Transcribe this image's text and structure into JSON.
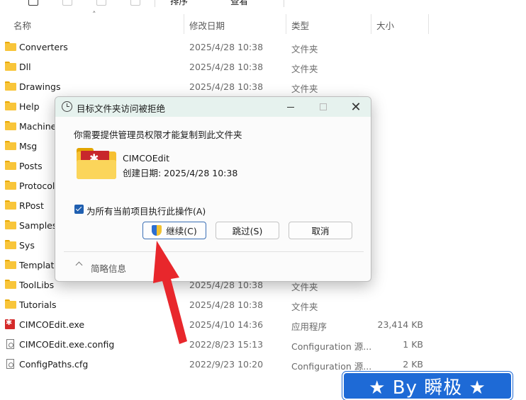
{
  "toolbar": {
    "sort_label": "排序",
    "view_label": "查看"
  },
  "columns": {
    "name": "名称",
    "modified": "修改日期",
    "type": "类型",
    "size": "大小"
  },
  "files": [
    {
      "icon": "folder-icon",
      "name": "Converters",
      "date": "2025/4/28 10:38",
      "type": "文件夹",
      "size": ""
    },
    {
      "icon": "folder-icon",
      "name": "Dll",
      "date": "2025/4/28 10:38",
      "type": "文件夹",
      "size": ""
    },
    {
      "icon": "folder-icon",
      "name": "Drawings",
      "date": "2025/4/28 10:38",
      "type": "文件夹",
      "size": ""
    },
    {
      "icon": "folder-icon",
      "name": "Help",
      "date": "",
      "type": "",
      "size": ""
    },
    {
      "icon": "folder-icon",
      "name": "Machine",
      "date": "",
      "type": "",
      "size": ""
    },
    {
      "icon": "folder-icon",
      "name": "Msg",
      "date": "",
      "type": "",
      "size": ""
    },
    {
      "icon": "folder-icon",
      "name": "Posts",
      "date": "",
      "type": "",
      "size": ""
    },
    {
      "icon": "folder-icon",
      "name": "Protocol",
      "date": "",
      "type": "",
      "size": ""
    },
    {
      "icon": "folder-icon",
      "name": "RPost",
      "date": "",
      "type": "",
      "size": ""
    },
    {
      "icon": "folder-icon",
      "name": "Samples",
      "date": "",
      "type": "",
      "size": ""
    },
    {
      "icon": "folder-icon",
      "name": "Sys",
      "date": "",
      "type": "",
      "size": ""
    },
    {
      "icon": "folder-icon",
      "name": "Template",
      "date": "",
      "type": "",
      "size": ""
    },
    {
      "icon": "folder-icon",
      "name": "ToolLibs",
      "date": "2025/4/28 10:38",
      "type": "文件夹",
      "size": ""
    },
    {
      "icon": "folder-icon",
      "name": "Tutorials",
      "date": "2025/4/28 10:38",
      "type": "文件夹",
      "size": ""
    },
    {
      "icon": "exe-icon",
      "name": "CIMCOEdit.exe",
      "date": "2025/4/10 14:36",
      "type": "应用程序",
      "size": "23,414 KB"
    },
    {
      "icon": "config-file-icon",
      "name": "CIMCOEdit.exe.config",
      "date": "2022/8/23 15:13",
      "type": "Configuration 源...",
      "size": "1 KB"
    },
    {
      "icon": "config-file-icon",
      "name": "ConfigPaths.cfg",
      "date": "2022/9/23 10:20",
      "type": "Configuration 源...",
      "size": "2 KB"
    }
  ],
  "dialog": {
    "title": "目标文件夹访问被拒绝",
    "message": "你需要提供管理员权限才能复制到此文件夹",
    "item_name": "CIMCOEdit",
    "item_date": "创建日期: 2025/4/28 10:38",
    "checkbox_label": "为所有当前项目执行此操作(A)",
    "checkbox_checked": true,
    "continue_label": "继续(C)",
    "skip_label": "跳过(S)",
    "cancel_label": "取消",
    "summary_label": "简略信息"
  },
  "watermark": {
    "text": "★ By 瞬极 ★"
  },
  "colors": {
    "accent": "#1f5fb0",
    "arrow": "#e8272c",
    "badge": "#1e6ad6",
    "titlebar": "#e6f2ee"
  }
}
